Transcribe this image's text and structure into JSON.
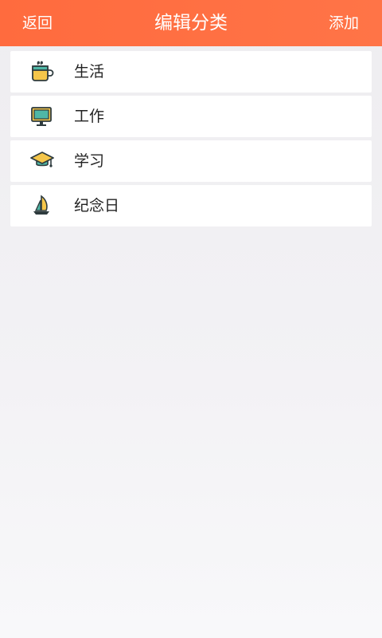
{
  "header": {
    "back_label": "返回",
    "title": "编辑分类",
    "add_label": "添加",
    "color": "#ff6e41"
  },
  "categories": [
    {
      "label": "生活",
      "icon": "mug-icon"
    },
    {
      "label": "工作",
      "icon": "monitor-icon"
    },
    {
      "label": "学习",
      "icon": "graduation-cap-icon"
    },
    {
      "label": "纪念日",
      "icon": "sailboat-icon"
    }
  ]
}
